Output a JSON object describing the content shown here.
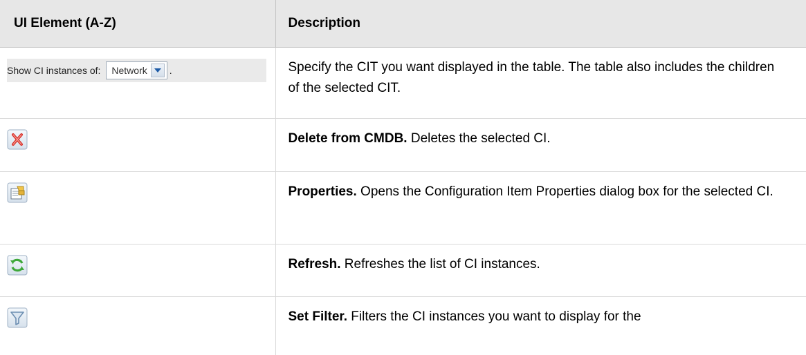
{
  "table": {
    "headers": [
      "UI Element (A-Z)",
      "Description"
    ],
    "rows": [
      {
        "element": {
          "label": "Show CI instances of:",
          "select_value": "Network",
          "trailing": "."
        },
        "description": "Specify the CIT you want displayed in the table. The table also includes the children of the selected CIT."
      },
      {
        "element": {
          "icon": "delete-icon"
        },
        "title": "Delete from CMDB.",
        "text": " Deletes the selected CI."
      },
      {
        "element": {
          "icon": "properties-icon"
        },
        "title": "Properties.",
        "text": " Opens the Configuration Item Properties dialog box for the selected CI."
      },
      {
        "element": {
          "icon": "refresh-icon"
        },
        "title": "Refresh.",
        "text": " Refreshes the list of CI instances."
      },
      {
        "element": {
          "icon": "filter-icon"
        },
        "title": "Set Filter.",
        "text": " Filters the CI instances you want to display for the"
      }
    ]
  },
  "colors": {
    "header_bg": "#e7e7e7",
    "delete_red": "#d8322a",
    "refresh_green": "#3ea83a",
    "filter_blue": "#6d8fb2"
  }
}
